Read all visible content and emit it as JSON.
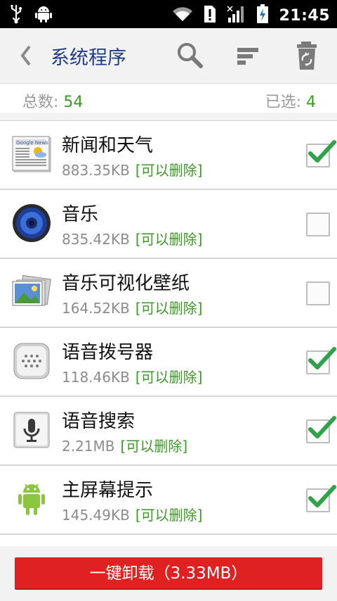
{
  "status_bar": {
    "time": "21:45",
    "icons": [
      "usb-icon",
      "android-debug-icon",
      "wifi-icon",
      "notice-icon",
      "signal-icon",
      "battery-charging-icon"
    ]
  },
  "header": {
    "title": "系统程序",
    "icons": [
      "back-chevron-icon",
      "search-icon",
      "sort-icon",
      "recycle-bin-icon"
    ]
  },
  "counts": {
    "total_label": "总数: ",
    "total_value": "54",
    "selected_label": "已选: ",
    "selected_value": "4"
  },
  "apps": [
    {
      "name": "新闻和天气",
      "size": "883.35KB",
      "tag": "[可以删除]",
      "checked": true,
      "icon": "google-news-icon"
    },
    {
      "name": "音乐",
      "size": "835.42KB",
      "tag": "[可以删除]",
      "checked": false,
      "icon": "speaker-icon"
    },
    {
      "name": "音乐可视化壁纸",
      "size": "164.52KB",
      "tag": "[可以删除]",
      "checked": false,
      "icon": "gallery-photos-icon"
    },
    {
      "name": "语音拨号器",
      "size": "118.46KB",
      "tag": "[可以删除]",
      "checked": true,
      "icon": "voice-dialer-icon"
    },
    {
      "name": "语音搜索",
      "size": "2.21MB",
      "tag": "[可以删除]",
      "checked": true,
      "icon": "microphone-icon"
    },
    {
      "name": "主屏幕提示",
      "size": "145.49KB",
      "tag": "[可以删除]",
      "checked": true,
      "icon": "android-robot-icon"
    }
  ],
  "footer": {
    "uninstall_label": "一键卸载（3.33MB）"
  },
  "colors": {
    "accent_green": "#3a9b24",
    "title_blue": "#1f3d8a",
    "button_red": "#e02121"
  }
}
